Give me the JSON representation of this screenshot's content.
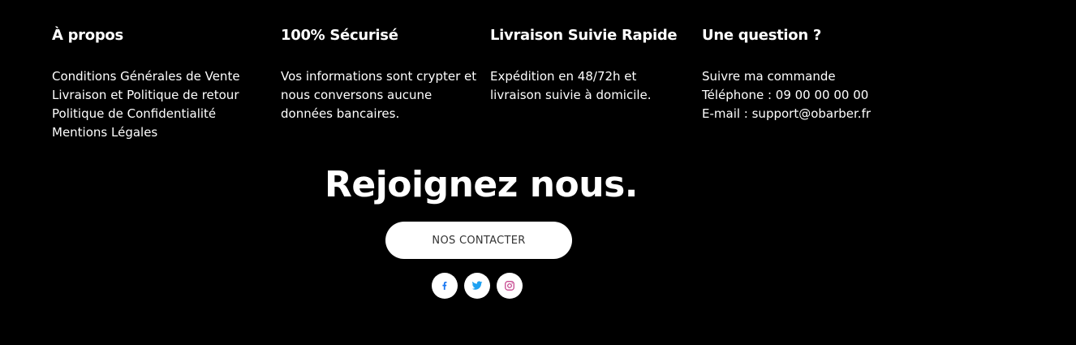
{
  "colors": {
    "background": "#000000",
    "text": "#ffffff",
    "button_bg": "#ffffff",
    "button_text": "#333333",
    "facebook": "#1877f2",
    "twitter": "#1da1f2",
    "instagram": "#c13584"
  },
  "footer": {
    "about": {
      "heading": "À propos",
      "links": [
        "Conditions Générales de Vente",
        "Livraison et Politique de retour",
        "Politique de Confidentialité",
        "Mentions Légales"
      ]
    },
    "secure": {
      "heading": "100% Sécurisé",
      "text": "Vos informations sont crypter et nous conversons aucune données bancaires."
    },
    "shipping": {
      "heading": "Livraison Suivie Rapide",
      "text": "Expédition en 48/72h et livraison suivie à domicile."
    },
    "question": {
      "heading": "Une question ?",
      "track_link": "Suivre ma commande",
      "phone": "Téléphone : 09 00 00 00 00",
      "email": "E-mail : support@obarber.fr"
    }
  },
  "join": {
    "title": "Rejoignez nous.",
    "button_label": "NOS CONTACTER"
  },
  "social": [
    {
      "name": "facebook",
      "icon": "facebook-icon"
    },
    {
      "name": "twitter",
      "icon": "twitter-icon"
    },
    {
      "name": "instagram",
      "icon": "instagram-icon"
    }
  ]
}
